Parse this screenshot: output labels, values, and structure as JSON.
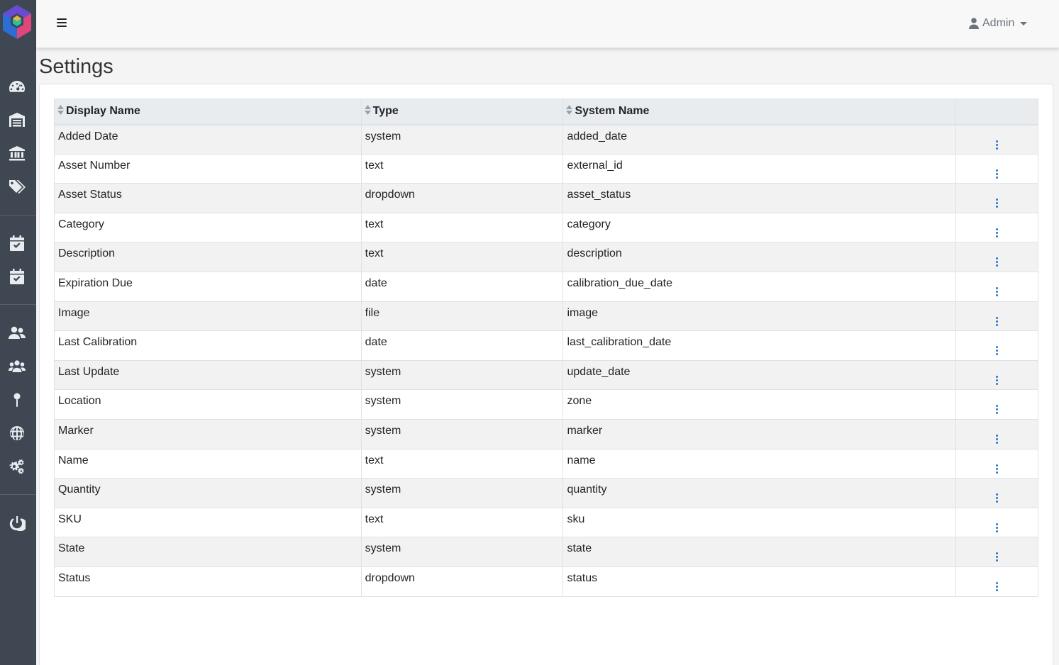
{
  "header": {
    "user_label": "Admin",
    "user_icon": "user-icon"
  },
  "page": {
    "title": "Settings"
  },
  "sidebar": {
    "items": [
      {
        "name": "dashboard-icon"
      },
      {
        "name": "warehouse-icon"
      },
      {
        "name": "bank-icon"
      },
      {
        "name": "tags-icon"
      },
      {
        "name": "calendar-check-icon"
      },
      {
        "name": "calendar-check-icon"
      },
      {
        "name": "users-icon"
      },
      {
        "name": "user-group-icon"
      },
      {
        "name": "map-pin-icon"
      },
      {
        "name": "globe-icon"
      },
      {
        "name": "settings-cogs-icon"
      },
      {
        "name": "power-icon"
      }
    ]
  },
  "table": {
    "columns": [
      "Display Name",
      "Type",
      "System Name",
      ""
    ],
    "rows": [
      {
        "display_name": "Added Date",
        "type": "system",
        "system_name": "added_date"
      },
      {
        "display_name": "Asset Number",
        "type": "text",
        "system_name": "external_id"
      },
      {
        "display_name": "Asset Status",
        "type": "dropdown",
        "system_name": "asset_status"
      },
      {
        "display_name": "Category",
        "type": "text",
        "system_name": "category"
      },
      {
        "display_name": "Description",
        "type": "text",
        "system_name": "description"
      },
      {
        "display_name": "Expiration Due",
        "type": "date",
        "system_name": "calibration_due_date"
      },
      {
        "display_name": "Image",
        "type": "file",
        "system_name": "image"
      },
      {
        "display_name": "Last Calibration",
        "type": "date",
        "system_name": "last_calibration_date"
      },
      {
        "display_name": "Last Update",
        "type": "system",
        "system_name": "update_date"
      },
      {
        "display_name": "Location",
        "type": "system",
        "system_name": "zone"
      },
      {
        "display_name": "Marker",
        "type": "system",
        "system_name": "marker"
      },
      {
        "display_name": "Name",
        "type": "text",
        "system_name": "name"
      },
      {
        "display_name": "Quantity",
        "type": "system",
        "system_name": "quantity"
      },
      {
        "display_name": "SKU",
        "type": "text",
        "system_name": "sku"
      },
      {
        "display_name": "State",
        "type": "system",
        "system_name": "state"
      },
      {
        "display_name": "Status",
        "type": "dropdown",
        "system_name": "status"
      }
    ]
  },
  "colors": {
    "sidebar_bg": "#3f4852",
    "accent": "#2a73c9",
    "header_bg": "#e9ecef"
  }
}
